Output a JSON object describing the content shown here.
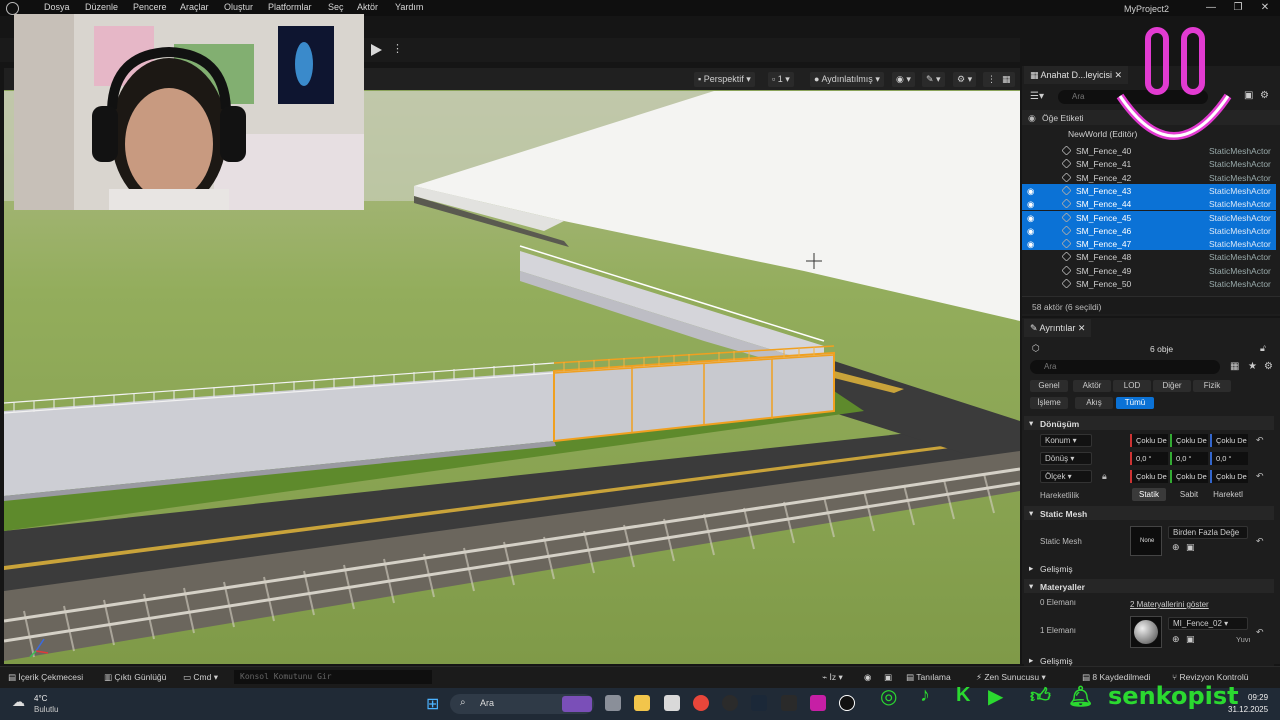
{
  "menu": [
    "Dosya",
    "Düzenle",
    "Pencere",
    "Araçlar",
    "Oluştur",
    "Platformlar",
    "Seç",
    "Aktör",
    "Yardım"
  ],
  "project_title": "MyProject2",
  "window_controls": [
    "—",
    "❐",
    "✕"
  ],
  "viewport": {
    "perspective_label": "Perspektif",
    "camera_label": "1",
    "lit_label": "Aydınlatılmış"
  },
  "outliner": {
    "tab_label": "Anahat D...leyicisi",
    "search_placeholder": "Ara",
    "header_label": "Öğe Etiketi",
    "world_label": "NewWorld (Editör)",
    "rows": [
      {
        "name": "SM_Fence_40",
        "type": "StaticMeshActor",
        "selected": false
      },
      {
        "name": "SM_Fence_41",
        "type": "StaticMeshActor",
        "selected": false
      },
      {
        "name": "SM_Fence_42",
        "type": "StaticMeshActor",
        "selected": false
      },
      {
        "name": "SM_Fence_43",
        "type": "StaticMeshActor",
        "selected": true
      },
      {
        "name": "SM_Fence_44",
        "type": "StaticMeshActor",
        "selected": true
      },
      {
        "name": "SM_Fence_45",
        "type": "StaticMeshActor",
        "selected": true
      },
      {
        "name": "SM_Fence_46",
        "type": "StaticMeshActor",
        "selected": true
      },
      {
        "name": "SM_Fence_47",
        "type": "StaticMeshActor",
        "selected": true
      },
      {
        "name": "SM_Fence_48",
        "type": "StaticMeshActor",
        "selected": false
      },
      {
        "name": "SM_Fence_49",
        "type": "StaticMeshActor",
        "selected": false
      },
      {
        "name": "SM_Fence_50",
        "type": "StaticMeshActor",
        "selected": false
      }
    ],
    "footer": "58 aktör (6 seçildi)"
  },
  "details": {
    "tab_label": "Ayrıntılar",
    "object_count": "6 obje",
    "search_placeholder": "Ara",
    "categories_row1": [
      "Genel",
      "Aktör",
      "LOD",
      "Diğer",
      "Fizik"
    ],
    "categories_row2": [
      "İşleme",
      "Akış",
      "Tümü"
    ],
    "active_category": "Tümü",
    "transform_section": "Dönüşüm",
    "location_label": "Konum",
    "location_values": [
      "Çoklu De",
      "Çoklu De",
      "Çoklu De"
    ],
    "rotation_label": "Dönüş",
    "rotation_values": [
      "0,0 °",
      "0,0 °",
      "0,0 °"
    ],
    "scale_label": "Ölçek",
    "scale_values": [
      "Çoklu De",
      "Çoklu De",
      "Çoklu De"
    ],
    "mobility_label": "Hareketlilik",
    "mobility_options": [
      "Statik",
      "Sabit",
      "Hareketl"
    ],
    "static_mesh_section": "Static Mesh",
    "static_mesh_label": "Static Mesh",
    "static_mesh_thumb": "None",
    "static_mesh_value": "Birden Fazla Değe",
    "advanced_label": "Gelişmiş",
    "materials_section": "Materyaller",
    "element0_label": "0 Elemanı",
    "element0_value": "2 Materyallerini göster",
    "element1_label": "1 Elemanı",
    "element1_value": "MI_Fence_02",
    "element1_extra": "Yuvı",
    "advanced2_label": "Gelişmiş"
  },
  "statusbar": {
    "content_drawer": "İçerik Çekmecesi",
    "output_log": "Çıktı Günlüğü",
    "cmd": "Cmd",
    "console_placeholder": "Konsol Komutunu Gir",
    "trace": "İz",
    "derive": "Tanılama",
    "zen": "Zen Sunucusu",
    "saved": "8 Kaydedilmedi",
    "revision": "Revizyon Kontrolü"
  },
  "taskbar": {
    "weather_temp": "4°C",
    "weather_desc": "Bulutlu",
    "search_label": "Ara",
    "time": "09:29",
    "date": "31.12.2025"
  },
  "overlay": {
    "handle": "senkopist"
  },
  "colors": {
    "selection": "#0b72d6",
    "accent_green": "#2bd930",
    "smiley": "#e23bd1",
    "fence_selected": "#f0a020"
  }
}
